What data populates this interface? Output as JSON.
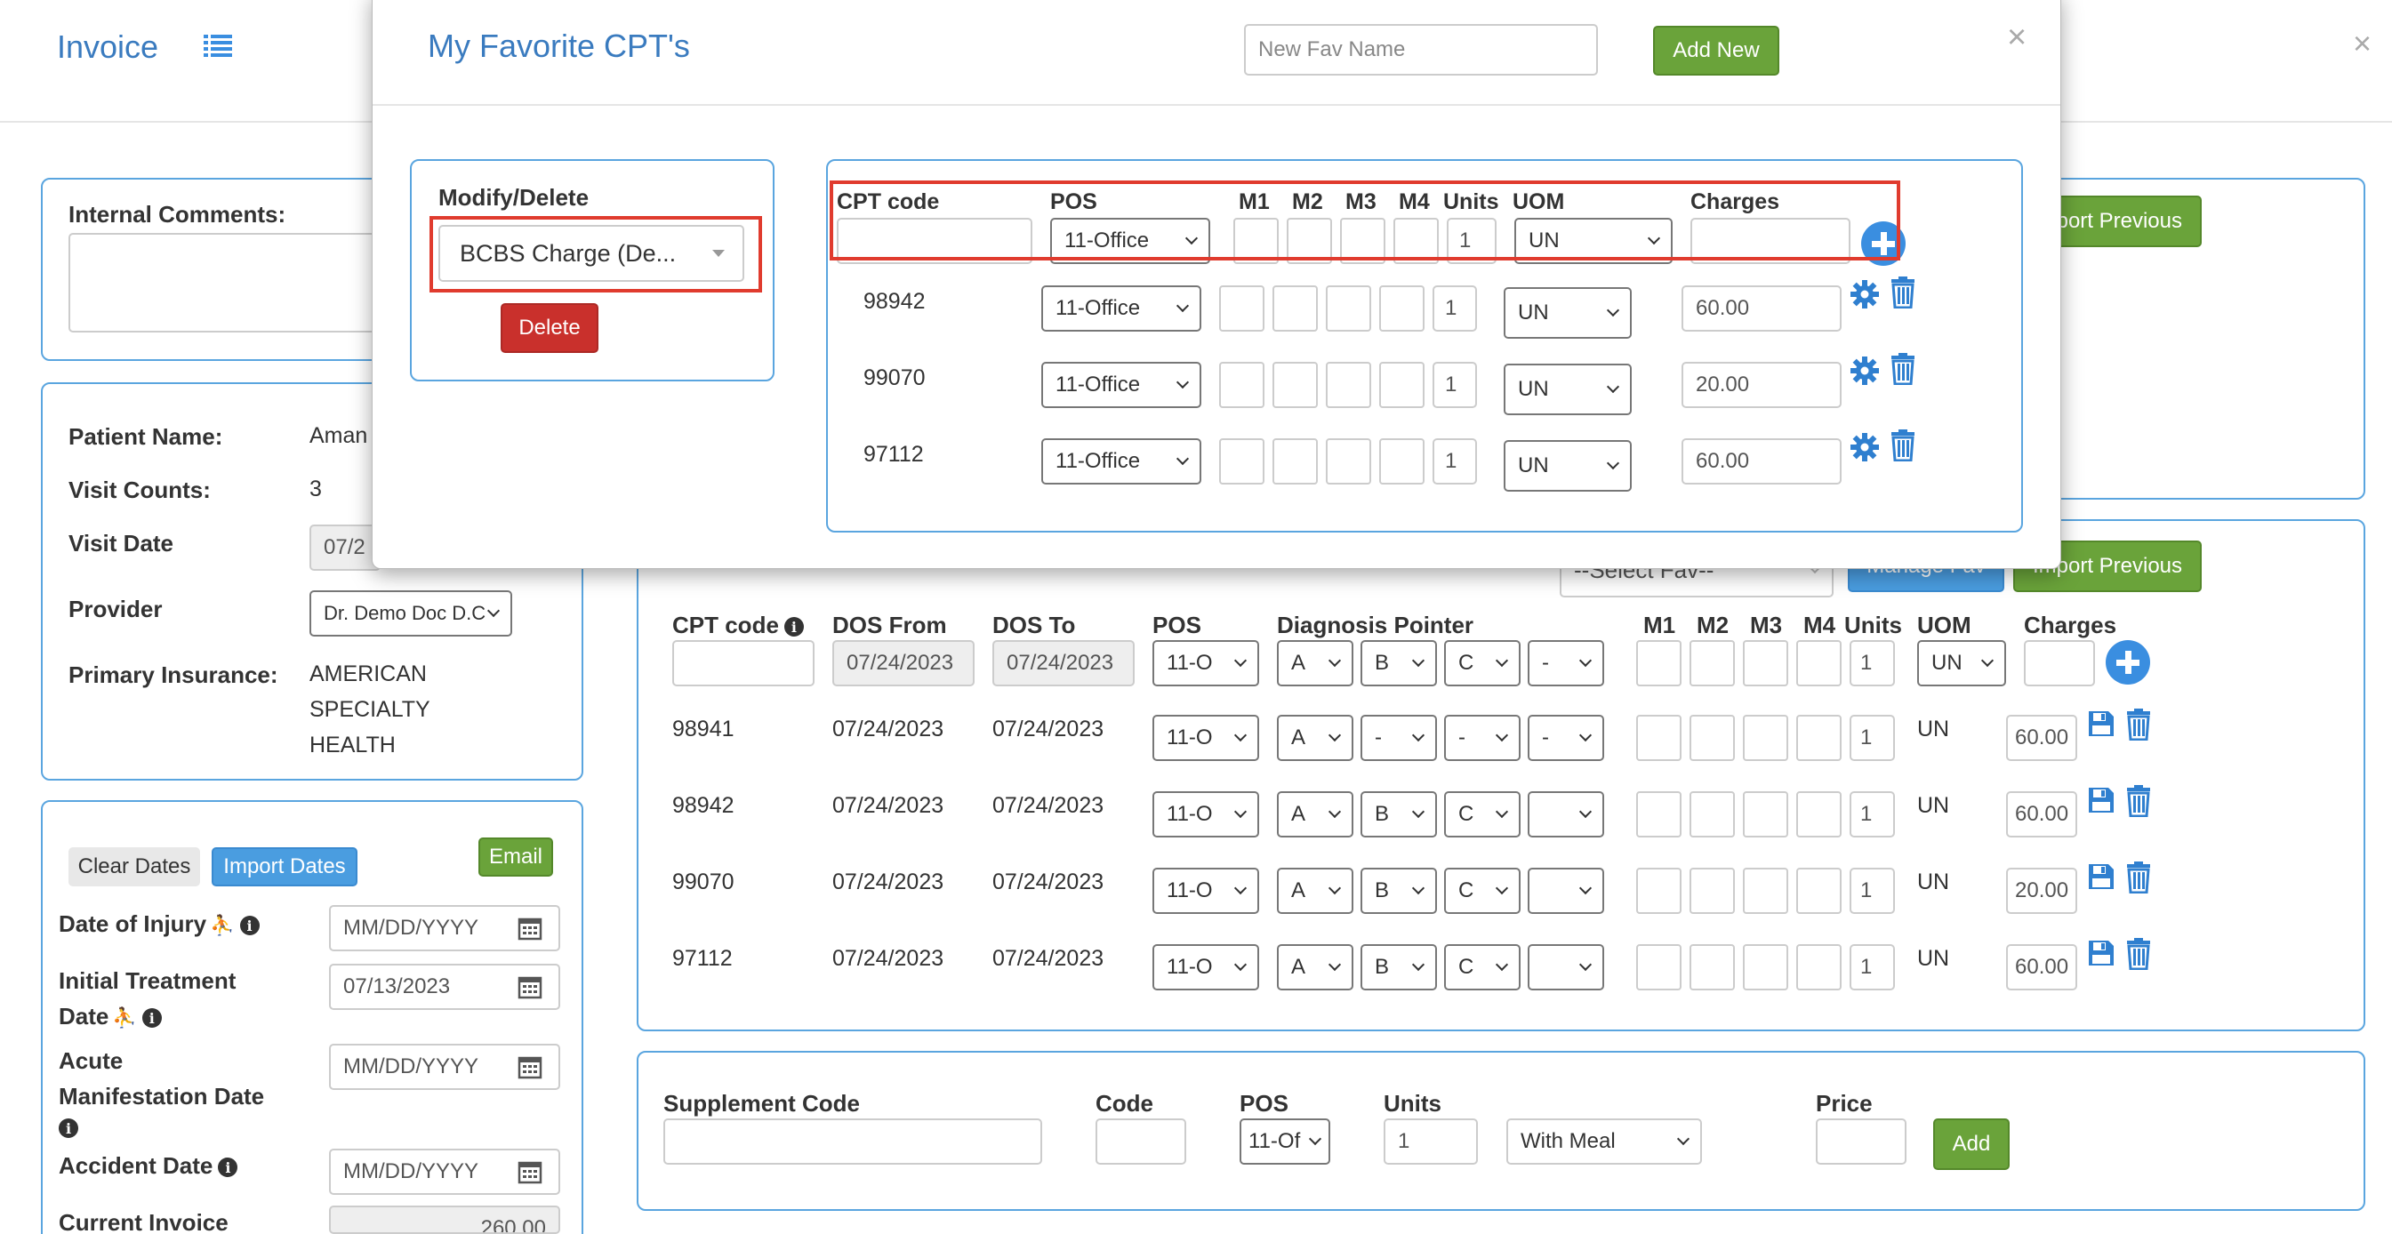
{
  "page": {
    "title": "Invoice",
    "close": "×"
  },
  "internal_comments": {
    "label": "Internal Comments:"
  },
  "patient": {
    "name_label": "Patient Name:",
    "name_value": "Aman",
    "visit_counts_label": "Visit Counts:",
    "visit_counts_value": "3",
    "visit_date_label": "Visit Date",
    "visit_date_value": "07/2",
    "provider_label": "Provider",
    "provider_value": "Dr. Demo Doc D.C",
    "insurance_label": "Primary Insurance:",
    "insurance_lines": [
      "AMERICAN",
      "SPECIALTY",
      "HEALTH"
    ]
  },
  "dates": {
    "clear_btn": "Clear Dates",
    "import_btn": "Import Dates",
    "email_btn": "Email",
    "injury_label": "Date of Injury",
    "injury_value": "MM/DD/YYYY",
    "initial_label_1": "Initial Treatment",
    "initial_label_2": "Date",
    "initial_value": "07/13/2023",
    "acute_label_1": "Acute",
    "acute_label_2": "Manifestation Date",
    "acute_value": "MM/DD/YYYY",
    "accident_label": "Accident Date",
    "accident_value": "MM/DD/YYYY",
    "current_invoice_label": "Current Invoice",
    "current_invoice_value": "260.00"
  },
  "top_right": {
    "import_previous": "Import Previous"
  },
  "charges": {
    "select_fav": "--Select Fav--",
    "manage_fav": "Manage Fav",
    "import_previous": "Import Previous",
    "headers": {
      "cpt": "CPT code",
      "dos_from": "DOS From",
      "dos_to": "DOS To",
      "pos": "POS",
      "diag": "Diagnosis Pointer",
      "m1": "M1",
      "m2": "M2",
      "m3": "M3",
      "m4": "M4",
      "units": "Units",
      "uom": "UOM",
      "charges": "Charges"
    },
    "new_row": {
      "dos_from": "07/24/2023",
      "dos_to": "07/24/2023",
      "pos": "11-O",
      "d1": "A",
      "d2": "B",
      "d3": "C",
      "d4": "-",
      "units": "1",
      "uom": "UN"
    },
    "rows": [
      {
        "cpt": "98941",
        "from": "07/24/2023",
        "to": "07/24/2023",
        "pos": "11-O",
        "d1": "A",
        "d2": "-",
        "d3": "-",
        "d4": "-",
        "units": "1",
        "uom": "UN",
        "charge": "60.00"
      },
      {
        "cpt": "98942",
        "from": "07/24/2023",
        "to": "07/24/2023",
        "pos": "11-O",
        "d1": "A",
        "d2": "B",
        "d3": "C",
        "d4": "",
        "units": "1",
        "uom": "UN",
        "charge": "60.00"
      },
      {
        "cpt": "99070",
        "from": "07/24/2023",
        "to": "07/24/2023",
        "pos": "11-O",
        "d1": "A",
        "d2": "B",
        "d3": "C",
        "d4": "",
        "units": "1",
        "uom": "UN",
        "charge": "20.00"
      },
      {
        "cpt": "97112",
        "from": "07/24/2023",
        "to": "07/24/2023",
        "pos": "11-O",
        "d1": "A",
        "d2": "B",
        "d3": "C",
        "d4": "",
        "units": "1",
        "uom": "UN",
        "charge": "60.00"
      }
    ]
  },
  "supplement": {
    "code_label": "Supplement Code",
    "code2_label": "Code",
    "pos_label": "POS",
    "pos_value": "11-Of",
    "units_label": "Units",
    "units_value": "1",
    "meal_value": "With Meal",
    "price_label": "Price",
    "add_btn": "Add"
  },
  "modal": {
    "title": "My Favorite CPT's",
    "new_fav_placeholder": "New Fav Name",
    "add_new_btn": "Add New",
    "close": "×",
    "modify_label": "Modify/Delete",
    "fav_selected": "BCBS Charge (De...",
    "delete_btn": "Delete",
    "headers": {
      "cpt": "CPT code",
      "pos": "POS",
      "m1": "M1",
      "m2": "M2",
      "m3": "M3",
      "m4": "M4",
      "units": "Units",
      "uom": "UOM",
      "charges": "Charges"
    },
    "new_row": {
      "pos": "11-Office",
      "units": "1",
      "uom": "UN"
    },
    "rows": [
      {
        "cpt": "98942",
        "pos": "11-Office",
        "units": "1",
        "uom": "UN",
        "charge": "60.00"
      },
      {
        "cpt": "99070",
        "pos": "11-Office",
        "units": "1",
        "uom": "UN",
        "charge": "20.00"
      },
      {
        "cpt": "97112",
        "pos": "11-Office",
        "units": "1",
        "uom": "UN",
        "charge": "60.00"
      }
    ]
  },
  "colors": {
    "accent": "#3a7bbf",
    "panel_border": "#5aa5df",
    "green": "#6aa33a",
    "blue": "#4a9de0",
    "red": "#c9302c",
    "highlight": "#e03b2e"
  }
}
